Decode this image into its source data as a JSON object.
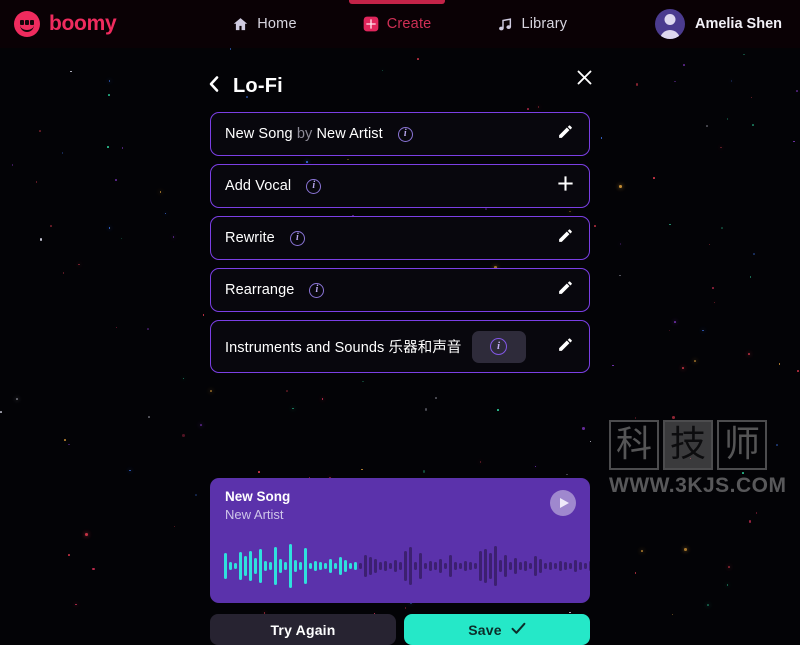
{
  "navbar": {
    "brand": "boomy",
    "brand_logo_icon": "boomy-smiley-logo-icon",
    "links": [
      {
        "label": "Home",
        "icon": "home-icon",
        "active": false
      },
      {
        "label": "Create",
        "icon": "create-plus-icon",
        "active": true
      },
      {
        "label": "Library",
        "icon": "music-note-icon",
        "active": false
      }
    ],
    "user": {
      "name": "Amelia Shen",
      "avatar_icon": "user-avatar-icon"
    }
  },
  "panel": {
    "back_icon": "chevron-left-icon",
    "title": "Lo-Fi",
    "close_icon": "close-x-icon",
    "rows": [
      {
        "label_main": "New Song",
        "label_muted": " by ",
        "label_tail": "New Artist",
        "info_icon": "info-icon",
        "info_focused": false,
        "action_icon": "pencil-edit-icon",
        "tall": false
      },
      {
        "label_main": "Add Vocal",
        "label_muted": "",
        "label_tail": "",
        "info_icon": "info-icon",
        "info_focused": false,
        "action_icon": "plus-icon",
        "tall": false
      },
      {
        "label_main": "Rewrite",
        "label_muted": "",
        "label_tail": "",
        "info_icon": "info-icon",
        "info_focused": false,
        "action_icon": "pencil-edit-icon",
        "tall": false
      },
      {
        "label_main": "Rearrange",
        "label_muted": "",
        "label_tail": "",
        "info_icon": "info-icon",
        "info_focused": false,
        "action_icon": "pencil-edit-icon",
        "tall": false
      },
      {
        "label_main": "Instruments and Sounds ",
        "label_muted": "",
        "label_tail": "乐器和声音",
        "info_icon": "info-icon",
        "info_focused": true,
        "action_icon": "pencil-edit-icon",
        "tall": true
      }
    ]
  },
  "player": {
    "title": "New Song",
    "artist": "New Artist",
    "play_icon": "play-icon",
    "progress_percent": 33,
    "waveform": {
      "played_color": "#2fe0dd",
      "unplayed_color": "#3c2070",
      "heights": [
        26,
        8,
        6,
        28,
        20,
        30,
        16,
        34,
        10,
        8,
        38,
        14,
        8,
        44,
        12,
        8,
        36,
        6,
        10,
        8,
        6,
        14,
        6,
        18,
        12,
        6,
        8,
        6,
        22,
        18,
        14,
        8,
        10,
        6,
        12,
        8,
        30,
        38,
        8,
        26,
        6,
        10,
        8,
        14,
        6,
        22,
        8,
        6,
        10,
        8,
        6,
        30,
        34,
        26,
        40,
        12,
        22,
        8,
        16,
        8,
        10,
        6,
        20,
        14,
        6,
        8,
        6,
        10,
        8,
        6,
        12,
        8,
        6,
        10,
        8,
        6,
        38,
        10,
        8,
        6,
        10
      ]
    }
  },
  "buttons": {
    "try_again": "Try Again",
    "save": "Save",
    "save_check_icon": "check-icon"
  },
  "watermark": {
    "chars": [
      "科",
      "技",
      "师"
    ],
    "url": "WWW.3KJS.COM"
  },
  "colors": {
    "accent_pink": "#ef2b5e",
    "accent_purple": "#7b3fe4",
    "player_purple": "#5b32ab",
    "save_teal": "#25e8c8",
    "wave_cyan": "#2fe0dd"
  }
}
